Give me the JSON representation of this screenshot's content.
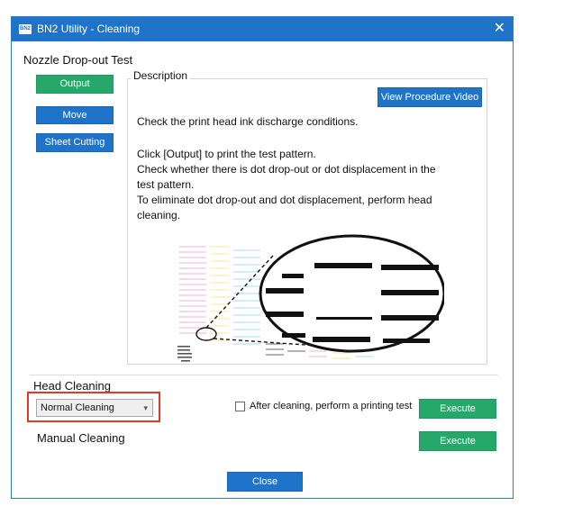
{
  "window": {
    "title": "BN2 Utility - Cleaning",
    "app_icon_text": "BN2"
  },
  "nozzle_test": {
    "group_label": "Nozzle Drop-out Test",
    "output_label": "Output",
    "move_label": "Move",
    "sheet_cutting_label": "Sheet Cutting"
  },
  "description": {
    "legend": "Description",
    "video_button_label": "View Procedure Video",
    "line1": "Check the print head ink discharge conditions.",
    "line2": "Click [Output] to print the test pattern.",
    "line3": "Check whether there is dot drop-out or dot displacement in the",
    "line4": "test pattern.",
    "line5": "To eliminate dot drop-out and dot displacement, perform head",
    "line6": "cleaning."
  },
  "head_cleaning": {
    "group_label": "Head Cleaning",
    "selected_option": "Normal Cleaning",
    "checkbox_label": "After cleaning, perform a printing test",
    "checkbox_checked": false,
    "execute_label": "Execute"
  },
  "manual_cleaning": {
    "label": "Manual Cleaning",
    "execute_label": "Execute"
  },
  "footer": {
    "close_label": "Close"
  },
  "colors": {
    "title_bar": "#1f73c9",
    "primary_button": "#1f73c9",
    "execute_button": "#27a86b",
    "highlight": "#e23a2a"
  }
}
